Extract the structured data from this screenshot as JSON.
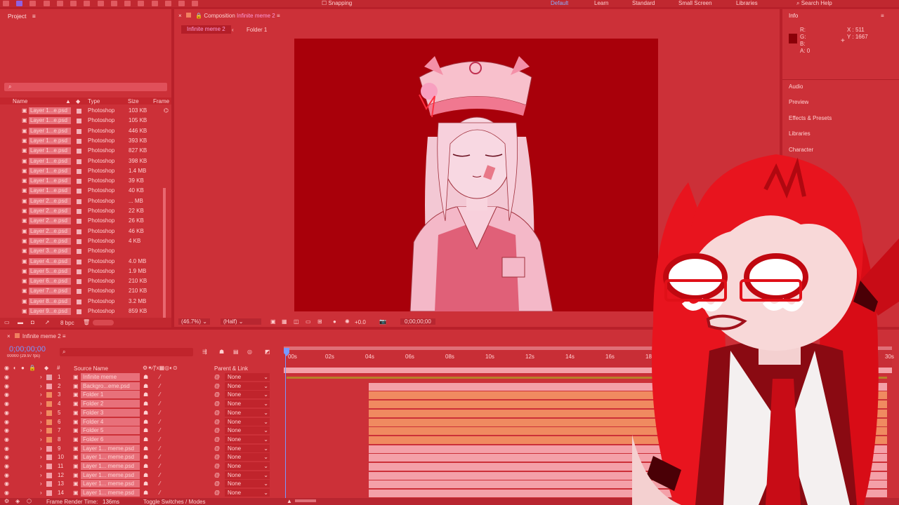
{
  "toolbar": {
    "snapping": "Snapping",
    "workspaces": [
      "Default",
      "Learn",
      "Standard",
      "Small Screen",
      "Libraries"
    ],
    "search_help": "Search Help"
  },
  "project": {
    "title": "Project",
    "columns": {
      "name": "Name",
      "type": "Type",
      "size": "Size",
      "frame": "Frame R"
    },
    "items": [
      {
        "name": "Layer 1...e.psd",
        "type": "Photoshop",
        "size": "103 KB"
      },
      {
        "name": "Layer 1...e.psd",
        "type": "Photoshop",
        "size": "105 KB"
      },
      {
        "name": "Layer 1...e.psd",
        "type": "Photoshop",
        "size": "446 KB"
      },
      {
        "name": "Layer 1...e.psd",
        "type": "Photoshop",
        "size": "393 KB"
      },
      {
        "name": "Layer 1...e.psd",
        "type": "Photoshop",
        "size": "827 KB"
      },
      {
        "name": "Layer 1...e.psd",
        "type": "Photoshop",
        "size": "398 KB"
      },
      {
        "name": "Layer 1...e.psd",
        "type": "Photoshop",
        "size": "1.4 MB"
      },
      {
        "name": "Layer 1...e.psd",
        "type": "Photoshop",
        "size": "39 KB"
      },
      {
        "name": "Layer 1...e.psd",
        "type": "Photoshop",
        "size": "40 KB"
      },
      {
        "name": "Layer 2...e.psd",
        "type": "Photoshop",
        "size": "... MB"
      },
      {
        "name": "Layer 2...e.psd",
        "type": "Photoshop",
        "size": "22 KB"
      },
      {
        "name": "Layer 2...e.psd",
        "type": "Photoshop",
        "size": "26 KB"
      },
      {
        "name": "Layer 2...e.psd",
        "type": "Photoshop",
        "size": "46 KB"
      },
      {
        "name": "Layer 2...e.psd",
        "type": "Photoshop",
        "size": "4 KB"
      },
      {
        "name": "Layer 3...e.psd",
        "type": "Photoshop",
        "size": ""
      },
      {
        "name": "Layer 4...e.psd",
        "type": "Photoshop",
        "size": "4.0 MB"
      },
      {
        "name": "Layer 5...e.psd",
        "type": "Photoshop",
        "size": "1.9 MB"
      },
      {
        "name": "Layer 6...e.psd",
        "type": "Photoshop",
        "size": "210 KB"
      },
      {
        "name": "Layer 7...e.psd",
        "type": "Photoshop",
        "size": "210 KB"
      },
      {
        "name": "Layer 8...e.psd",
        "type": "Photoshop",
        "size": "3.2 MB"
      },
      {
        "name": "Layer 9...e.psd",
        "type": "Photoshop",
        "size": "859 KB"
      }
    ],
    "bpc": "8 bpc"
  },
  "composition": {
    "panel_label": "Composition",
    "comp_name": "Infinite meme 2",
    "breadcrumb": [
      "Infinite meme 2",
      "Folder 1"
    ],
    "zoom": "(46.7%)",
    "resolution": "(Half)",
    "exposure": "+0.0",
    "timecode": "0;00;00;00"
  },
  "info": {
    "title": "Info",
    "r": "R:",
    "g": "G:",
    "b": "B:",
    "a": "A: 0",
    "x": "X : 511",
    "y": "Y : 1667",
    "sections": [
      "Audio",
      "Preview",
      "Effects & Presets",
      "Libraries",
      "Character"
    ]
  },
  "timeline": {
    "tab": "Infinite meme 2",
    "timecode": "0;00;00;00",
    "fps": "00000 (29.97 fps)",
    "headers": {
      "source": "Source Name",
      "parent": "Parent & Link"
    },
    "ruler": [
      "00s",
      "02s",
      "04s",
      "06s",
      "08s",
      "10s",
      "12s",
      "14s",
      "16s",
      "18s",
      "30s"
    ],
    "layers": [
      {
        "num": "1",
        "name": "Infinite meme",
        "parent": "None",
        "color": "#e8a0a8"
      },
      {
        "num": "2",
        "name": "Backgro...eme.psd",
        "parent": "None",
        "color": "#f4a0a8"
      },
      {
        "num": "3",
        "name": "Folder 1",
        "parent": "None",
        "color": "#f08a60"
      },
      {
        "num": "4",
        "name": "Folder 2",
        "parent": "None",
        "color": "#f08a60"
      },
      {
        "num": "5",
        "name": "Folder 3",
        "parent": "None",
        "color": "#f08a60"
      },
      {
        "num": "6",
        "name": "Folder 4",
        "parent": "None",
        "color": "#f08a60"
      },
      {
        "num": "7",
        "name": "Folder 5",
        "parent": "None",
        "color": "#f08a60"
      },
      {
        "num": "8",
        "name": "Folder 6",
        "parent": "None",
        "color": "#f08a60"
      },
      {
        "num": "9",
        "name": "Layer 1... meme.psd",
        "parent": "None",
        "color": "#f4a0a8"
      },
      {
        "num": "10",
        "name": "Layer 1... meme.psd",
        "parent": "None",
        "color": "#f4a0a8"
      },
      {
        "num": "11",
        "name": "Layer 1... meme.psd",
        "parent": "None",
        "color": "#f4a0a8"
      },
      {
        "num": "12",
        "name": "Layer 1... meme.psd",
        "parent": "None",
        "color": "#f4a0a8"
      },
      {
        "num": "13",
        "name": "Layer 1... meme.psd",
        "parent": "None",
        "color": "#f4a0a8"
      },
      {
        "num": "14",
        "name": "Layer 1... meme.psd",
        "parent": "None",
        "color": "#f4a0a8"
      }
    ],
    "render_time_label": "Frame Render Time:",
    "render_time": "136ms",
    "toggle": "Toggle Switches / Modes"
  }
}
